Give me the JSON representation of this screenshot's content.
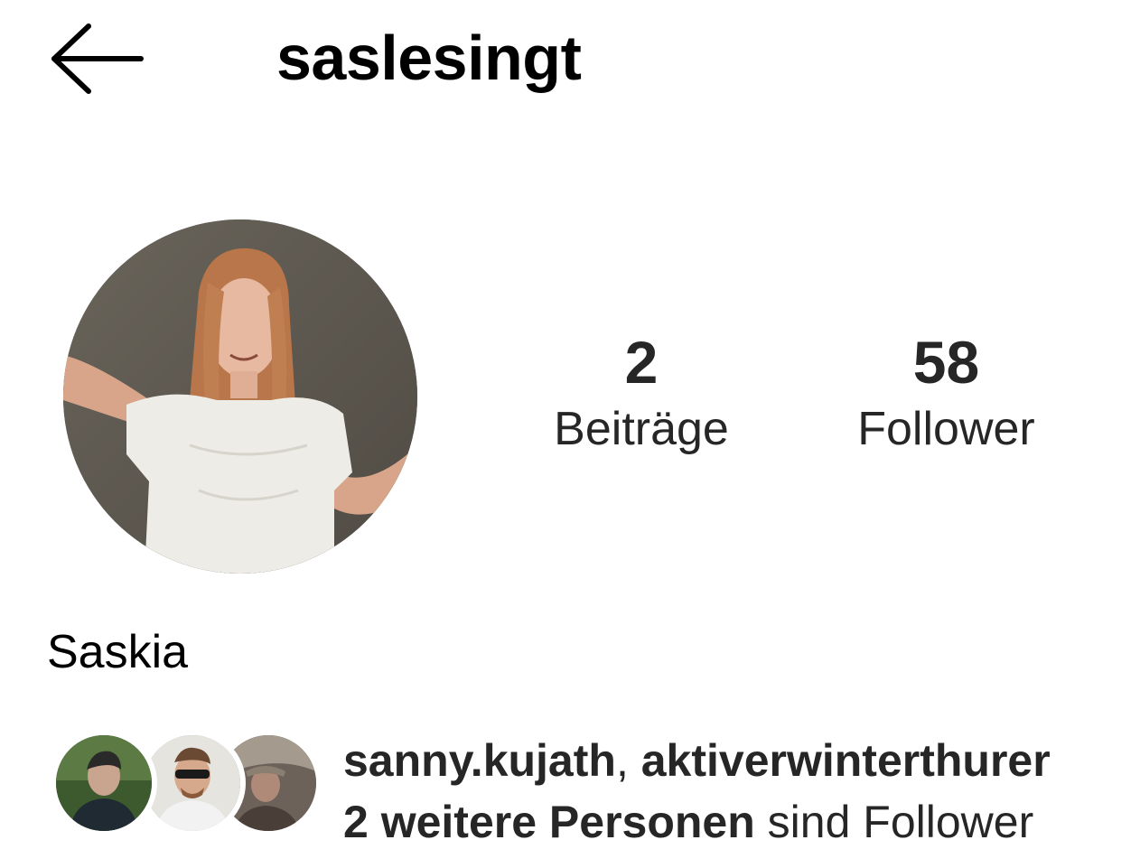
{
  "header": {
    "back_icon": "arrow-left-icon",
    "username": "saslesingt"
  },
  "profile": {
    "avatar_alt": "profile photo",
    "stats": {
      "posts": {
        "value": "2",
        "label": "Beiträge"
      },
      "followers": {
        "value": "58",
        "label": "Follower"
      }
    },
    "display_name": "Saskia"
  },
  "followed_by": {
    "user1": "sanny.kujath",
    "separator": ", ",
    "user2": "aktiverwinterthurer",
    "others": "2 weitere Personen",
    "suffix": " sind Follower"
  },
  "colors": {
    "text": "#262626",
    "background": "#ffffff"
  }
}
